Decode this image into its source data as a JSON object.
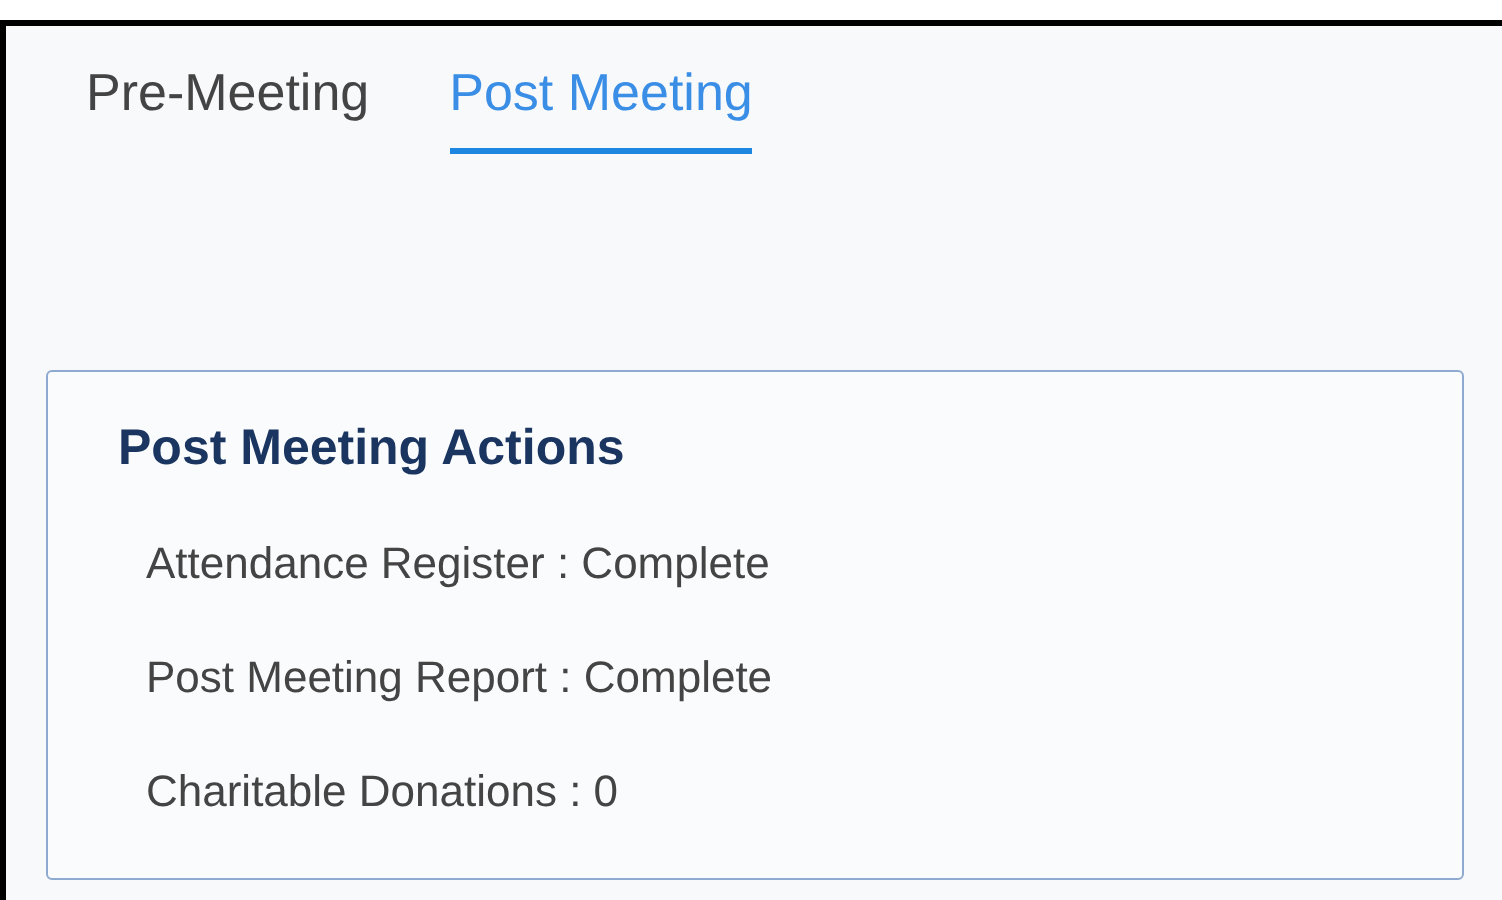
{
  "tabs": [
    {
      "label": "Pre-Meeting",
      "selected": false
    },
    {
      "label": "Post Meeting",
      "selected": true
    }
  ],
  "panel": {
    "title": "Post Meeting Actions",
    "items": [
      "Attendance Register : Complete",
      "Post Meeting Report : Complete",
      "Charitable Donations : 0"
    ]
  }
}
